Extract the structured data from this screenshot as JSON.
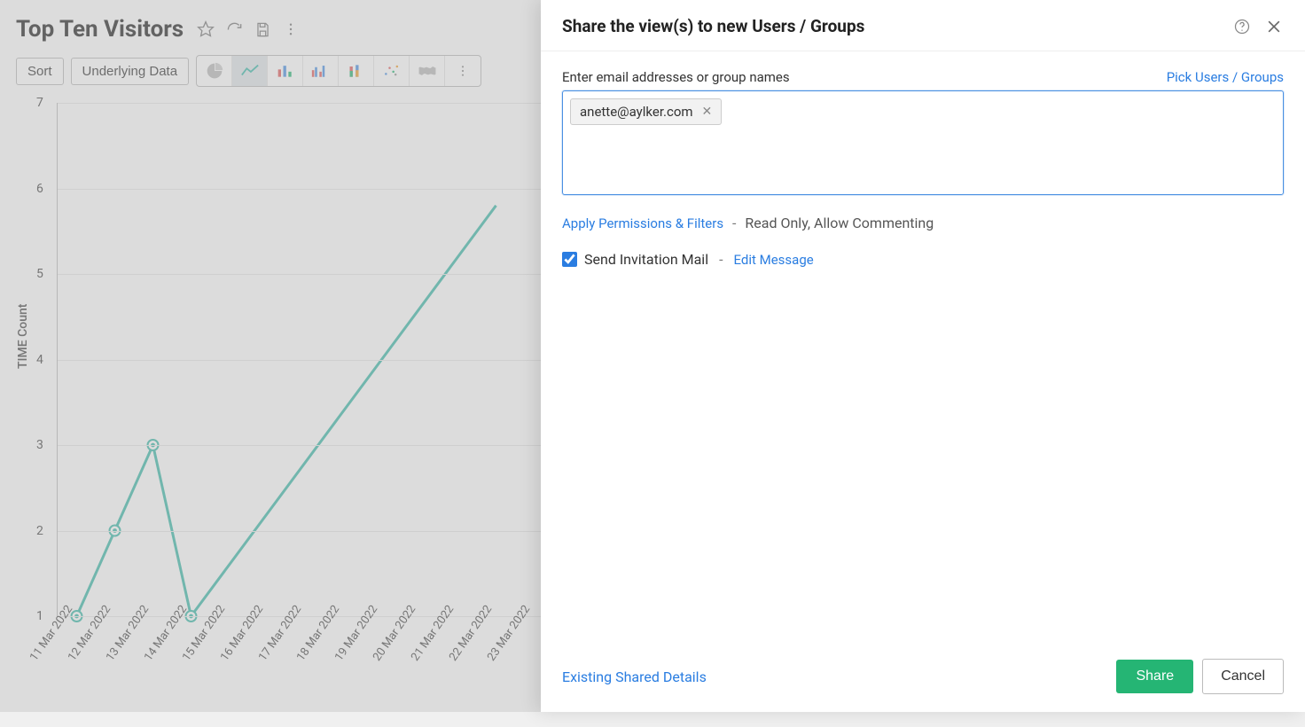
{
  "header": {
    "title": "Top Ten Visitors"
  },
  "toolbar": {
    "sort_label": "Sort",
    "underlying_label": "Underlying Data"
  },
  "modal": {
    "title": "Share the view(s) to new Users / Groups",
    "field_label": "Enter email addresses or group names",
    "pick_link": "Pick Users / Groups",
    "chip_email": "anette@aylker.com",
    "perm_link": "Apply Permissions & Filters",
    "perm_sep": "-",
    "perm_desc": "Read Only, Allow Commenting",
    "mail_label": "Send Invitation Mail",
    "mail_sep": "-",
    "edit_msg": "Edit Message",
    "existing": "Existing Shared Details",
    "share_btn": "Share",
    "cancel_btn": "Cancel"
  },
  "chart_data": {
    "type": "line",
    "ylabel": "TIME Count",
    "ylim": [
      1,
      7
    ],
    "yticks": [
      1,
      2,
      3,
      4,
      5,
      6,
      7
    ],
    "categories": [
      "11 Mar 2022",
      "12 Mar 2022",
      "13 Mar 2022",
      "14 Mar 2022",
      "15 Mar 2022",
      "16 Mar 2022",
      "17 Mar 2022",
      "18 Mar 2022",
      "19 Mar 2022",
      "20 Mar 2022",
      "21 Mar 2022",
      "22 Mar 2022",
      "23 Mar 2022"
    ],
    "values": [
      1,
      2,
      3,
      1,
      null,
      null,
      null,
      null,
      null,
      null,
      null,
      null,
      null
    ],
    "visible_line_end_x": 11,
    "visible_line_end_y": 5.8
  }
}
